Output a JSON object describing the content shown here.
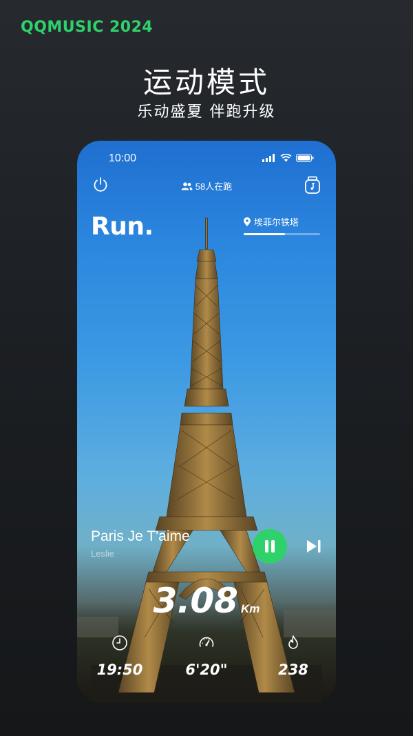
{
  "brand": "QQMUSIC 2024",
  "hero": {
    "title": "运动模式",
    "subtitle": "乐动盛夏  伴跑升级"
  },
  "status": {
    "time": "10:00"
  },
  "top": {
    "runners": "58人在跑"
  },
  "run_label": "Run.",
  "location": {
    "name": "埃菲尔铁塔",
    "progress": 0.54
  },
  "song": {
    "title": "Paris Je T'aime",
    "artist": "Leslie"
  },
  "distance": {
    "value": "3.08",
    "unit": "Km"
  },
  "stats": [
    {
      "icon": "clock-icon",
      "value": "19:50"
    },
    {
      "icon": "speedometer-icon",
      "value": "6'20\""
    },
    {
      "icon": "flame-icon",
      "value": "238"
    }
  ],
  "colors": {
    "accent": "#2fd26a"
  }
}
